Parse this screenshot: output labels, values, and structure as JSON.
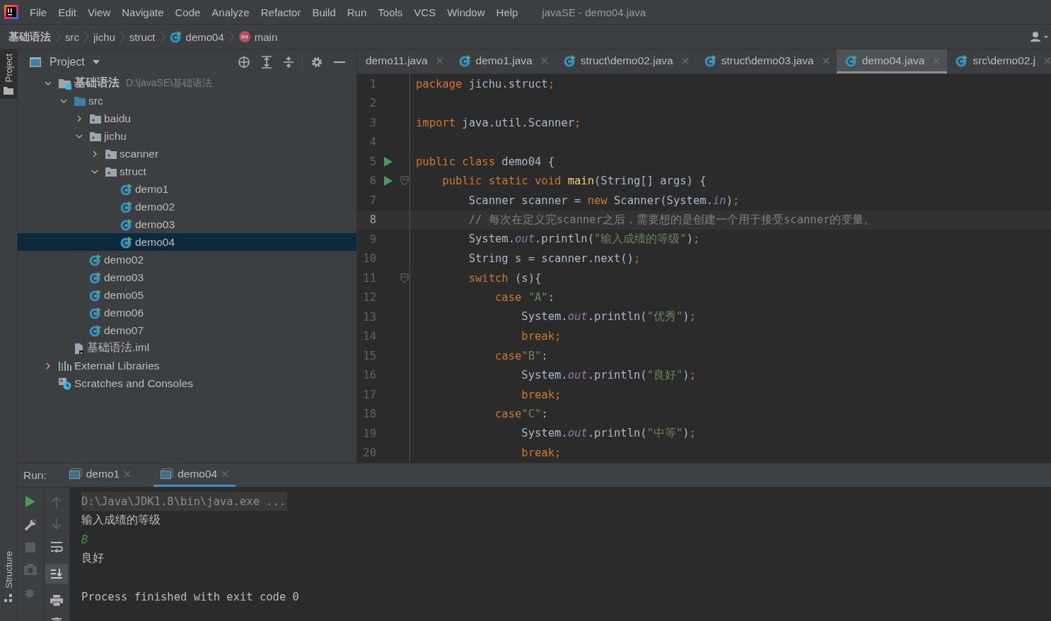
{
  "menu": {
    "items": [
      "File",
      "Edit",
      "View",
      "Navigate",
      "Code",
      "Analyze",
      "Refactor",
      "Build",
      "Run",
      "Tools",
      "VCS",
      "Window",
      "Help"
    ],
    "title": "javaSE - demo04.java"
  },
  "breadcrumb": [
    {
      "kind": "module",
      "label": "基础语法"
    },
    {
      "kind": "folder",
      "label": "src"
    },
    {
      "kind": "folder",
      "label": "jichu"
    },
    {
      "kind": "folder",
      "label": "struct"
    },
    {
      "kind": "class",
      "label": "demo04"
    },
    {
      "kind": "method",
      "label": "main"
    }
  ],
  "side_tabs": [
    {
      "label": "Project",
      "selected": true,
      "kind": "project"
    },
    {
      "label": "Structure",
      "selected": false,
      "kind": "structure"
    }
  ],
  "project_panel": {
    "title": "Project"
  },
  "tree": [
    {
      "kind": "project",
      "label": "基础语法",
      "path": "D:\\javaSE\\基础语法",
      "expanded": true,
      "selected": false,
      "children": [
        {
          "kind": "source",
          "label": "src",
          "expanded": true,
          "selected": false,
          "children": [
            {
              "kind": "package",
              "label": "baidu",
              "expanded": false,
              "selected": false
            },
            {
              "kind": "package",
              "label": "jichu",
              "expanded": true,
              "selected": false,
              "children": [
                {
                  "kind": "package",
                  "label": "scanner",
                  "expanded": false,
                  "selected": false
                },
                {
                  "kind": "package",
                  "label": "struct",
                  "expanded": true,
                  "selected": false,
                  "children": [
                    {
                      "kind": "class",
                      "label": "demo1",
                      "selected": false
                    },
                    {
                      "kind": "class",
                      "label": "demo02",
                      "selected": false
                    },
                    {
                      "kind": "class",
                      "label": "demo03",
                      "selected": false
                    },
                    {
                      "kind": "class",
                      "label": "demo04",
                      "selected": true
                    }
                  ]
                }
              ]
            },
            {
              "kind": "class",
              "label": "demo02",
              "selected": false
            },
            {
              "kind": "class",
              "label": "demo03",
              "selected": false
            },
            {
              "kind": "class",
              "label": "demo05",
              "selected": false
            },
            {
              "kind": "class",
              "label": "demo06",
              "selected": false
            },
            {
              "kind": "class",
              "label": "demo07",
              "selected": false
            }
          ]
        },
        {
          "kind": "module-file",
          "label": "基础语法.iml",
          "selected": false
        }
      ]
    },
    {
      "kind": "libraries",
      "label": "External Libraries",
      "expanded": false,
      "selected": false
    },
    {
      "kind": "scratches",
      "label": "Scratches and Consoles",
      "selected": false
    }
  ],
  "editor_tabs": [
    {
      "label": "demo11.java",
      "selected": false,
      "icon": false
    },
    {
      "label": "demo1.java",
      "selected": false,
      "icon": true
    },
    {
      "label": "struct\\demo02.java",
      "selected": false,
      "icon": true
    },
    {
      "label": "struct\\demo03.java",
      "selected": false,
      "icon": true
    },
    {
      "label": "demo04.java",
      "selected": true,
      "icon": true
    },
    {
      "label": "src\\demo02.j",
      "selected": false,
      "icon": true
    }
  ],
  "code": [
    {
      "number": "1",
      "current": false,
      "tokens": [
        {
          "kind": "keyword",
          "text": "package "
        },
        {
          "kind": "plain",
          "text": "jichu.struct"
        },
        {
          "kind": "keyword",
          "text": ";"
        }
      ]
    },
    {
      "number": "2",
      "current": false
    },
    {
      "number": "3",
      "current": false,
      "tokens": [
        {
          "kind": "keyword",
          "text": "import "
        },
        {
          "kind": "plain",
          "text": "java.util.Scanner"
        },
        {
          "kind": "keyword",
          "text": ";"
        }
      ]
    },
    {
      "number": "4",
      "current": false
    },
    {
      "number": "5",
      "current": false,
      "run": true,
      "tokens": [
        {
          "kind": "keyword",
          "text": "public class "
        },
        {
          "kind": "plain",
          "text": "demo04 {"
        }
      ]
    },
    {
      "number": "6",
      "current": false,
      "run": true,
      "fold": true,
      "tokens": [
        {
          "kind": "keyword",
          "text": "    public static void "
        },
        {
          "kind": "declaration",
          "text": "main"
        },
        {
          "kind": "plain",
          "text": "(String[] args) {"
        }
      ]
    },
    {
      "number": "7",
      "current": false,
      "tokens": [
        {
          "kind": "plain",
          "text": "        Scanner scanner = "
        },
        {
          "kind": "keyword",
          "text": "new "
        },
        {
          "kind": "plain",
          "text": "Scanner(System."
        },
        {
          "kind": "static",
          "text": "in"
        },
        {
          "kind": "plain",
          "text": ")"
        },
        {
          "kind": "keyword",
          "text": ";"
        }
      ]
    },
    {
      "number": "8",
      "current": true,
      "tokens": [
        {
          "kind": "comment",
          "text": "        // 每次在定义完scanner之后，需要想的是创建一个用于接受scanner的变量。"
        }
      ]
    },
    {
      "number": "9",
      "current": false,
      "tokens": [
        {
          "kind": "plain",
          "text": "        System."
        },
        {
          "kind": "static",
          "text": "out"
        },
        {
          "kind": "plain",
          "text": ".println("
        },
        {
          "kind": "string",
          "text": "\"输入成绩的等级\""
        },
        {
          "kind": "plain",
          "text": ")"
        },
        {
          "kind": "keyword",
          "text": ";"
        }
      ]
    },
    {
      "number": "10",
      "current": false,
      "tokens": [
        {
          "kind": "plain",
          "text": "        String s = scanner.next()"
        },
        {
          "kind": "keyword",
          "text": ";"
        }
      ]
    },
    {
      "number": "11",
      "current": false,
      "fold": true,
      "tokens": [
        {
          "kind": "keyword",
          "text": "        switch "
        },
        {
          "kind": "plain",
          "text": "(s){"
        }
      ]
    },
    {
      "number": "12",
      "current": false,
      "tokens": [
        {
          "kind": "keyword",
          "text": "            case "
        },
        {
          "kind": "string",
          "text": "\"A\""
        },
        {
          "kind": "plain",
          "text": ":"
        }
      ]
    },
    {
      "number": "13",
      "current": false,
      "tokens": [
        {
          "kind": "plain",
          "text": "                System."
        },
        {
          "kind": "static",
          "text": "out"
        },
        {
          "kind": "plain",
          "text": ".println("
        },
        {
          "kind": "string",
          "text": "\"优秀\""
        },
        {
          "kind": "plain",
          "text": ")"
        },
        {
          "kind": "keyword",
          "text": ";"
        }
      ]
    },
    {
      "number": "14",
      "current": false,
      "tokens": [
        {
          "kind": "keyword",
          "text": "                break;"
        }
      ]
    },
    {
      "number": "15",
      "current": false,
      "tokens": [
        {
          "kind": "keyword",
          "text": "            case"
        },
        {
          "kind": "string",
          "text": "\"B\""
        },
        {
          "kind": "plain",
          "text": ":"
        }
      ]
    },
    {
      "number": "16",
      "current": false,
      "tokens": [
        {
          "kind": "plain",
          "text": "                System."
        },
        {
          "kind": "static",
          "text": "out"
        },
        {
          "kind": "plain",
          "text": ".println("
        },
        {
          "kind": "string",
          "text": "\"良好\""
        },
        {
          "kind": "plain",
          "text": ")"
        },
        {
          "kind": "keyword",
          "text": ";"
        }
      ]
    },
    {
      "number": "17",
      "current": false,
      "tokens": [
        {
          "kind": "keyword",
          "text": "                break;"
        }
      ]
    },
    {
      "number": "18",
      "current": false,
      "tokens": [
        {
          "kind": "keyword",
          "text": "            case"
        },
        {
          "kind": "string",
          "text": "\"C\""
        },
        {
          "kind": "plain",
          "text": ":"
        }
      ]
    },
    {
      "number": "19",
      "current": false,
      "tokens": [
        {
          "kind": "plain",
          "text": "                System."
        },
        {
          "kind": "static",
          "text": "out"
        },
        {
          "kind": "plain",
          "text": ".println("
        },
        {
          "kind": "string",
          "text": "\"中等\""
        },
        {
          "kind": "plain",
          "text": ")"
        },
        {
          "kind": "keyword",
          "text": ";"
        }
      ]
    },
    {
      "number": "20",
      "current": false,
      "tokens": [
        {
          "kind": "keyword",
          "text": "                break;"
        }
      ]
    }
  ],
  "run_panel": {
    "label": "Run:",
    "tabs": [
      {
        "label": "demo1",
        "selected": false
      },
      {
        "label": "demo04",
        "selected": true
      }
    ],
    "console": [
      {
        "kind": "command",
        "text": "D:\\Java\\JDK1.8\\bin\\java.exe ..."
      },
      {
        "kind": "output",
        "text": "输入成绩的等级"
      },
      {
        "kind": "input",
        "text": "B"
      },
      {
        "kind": "output",
        "text": "良好"
      },
      {
        "kind": "exit",
        "text": "Process finished with exit code 0"
      }
    ]
  }
}
